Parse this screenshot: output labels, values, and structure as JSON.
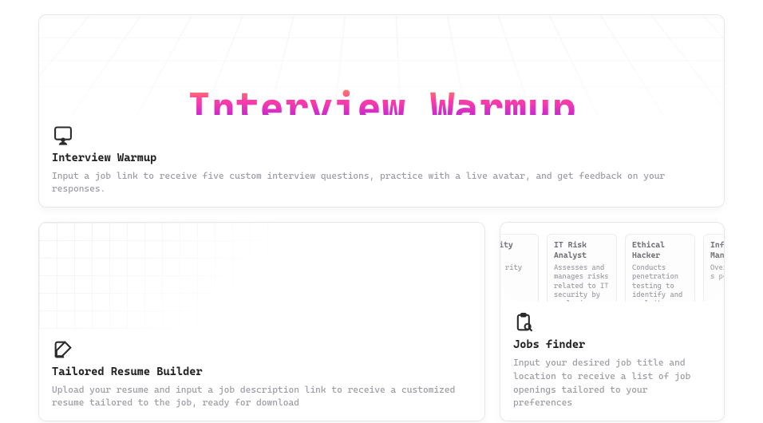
{
  "hero": {
    "big_title": "Interview Warmup",
    "icon": "person-screen-icon",
    "title": "Interview Warmup",
    "desc": "Input a job link to receive five custom interview questions, practice with a live avatar, and get feedback on your responses."
  },
  "resume": {
    "icon": "pencil-note-icon",
    "title": "Tailored Resume Builder",
    "desc": "Upload your resume and input a job description link to receive a customized resume tailored to the job, ready for download"
  },
  "jobs": {
    "icon": "clipboard-search-icon",
    "title": "Jobs finder",
    "desc": "Input your desired job title and location to receive a list of job openings tailored to your preferences",
    "chips": [
      {
        "title": "Security tant",
        "body": "advice rity"
      },
      {
        "title": "IT Risk Analyst",
        "body": "Assesses and manages risks related to IT security by analyzing potential"
      },
      {
        "title": "Ethical Hacker",
        "body": "Conducts penetration testing to identify and exploit vulnerabilities"
      },
      {
        "title": "Info Secu Mana",
        "body": "Over impl of s poli"
      }
    ]
  }
}
